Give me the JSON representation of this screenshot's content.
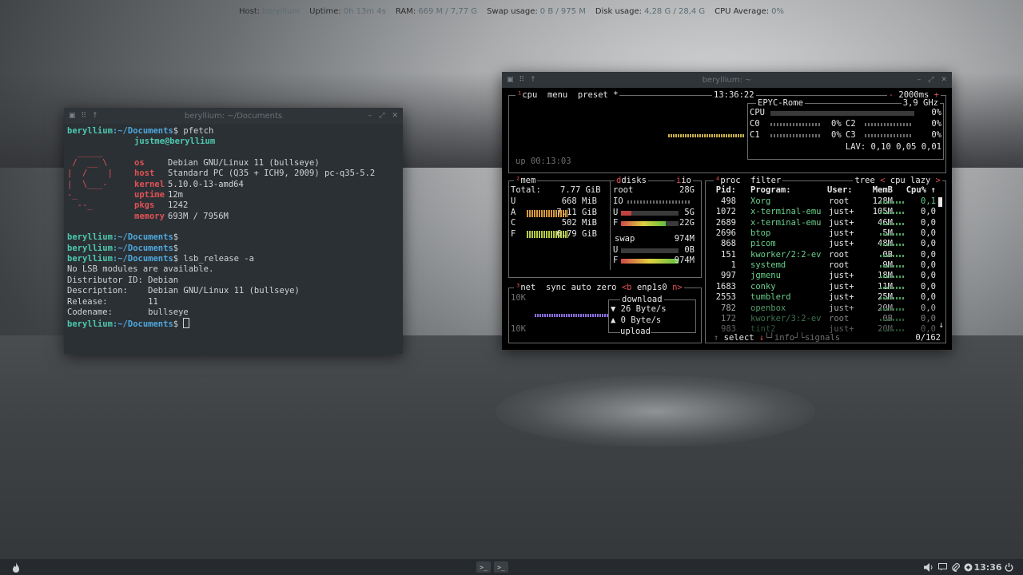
{
  "conky": [
    {
      "label": "Host:",
      "value": "beryllium"
    },
    {
      "label": "Uptime:",
      "value": "0h 13m 4s"
    },
    {
      "label": "RAM:",
      "value": "669 M / 7,77 G"
    },
    {
      "label": "Swap usage:",
      "value": "0 B / 975 M"
    },
    {
      "label": "Disk usage:",
      "value": "4,28 G / 28,4 G"
    },
    {
      "label": "CPU Average:",
      "value": "0%"
    }
  ],
  "term1": {
    "title": "beryllium: ~/Documents",
    "prompt_host": "beryllium",
    "prompt_path": ":~/Documents",
    "prompt_sign": "$",
    "cmd1": " pfetch",
    "pf_user": "justme@beryllium",
    "pf_logo": [
      "  _____",
      " /  __ \\",
      "|  /    |",
      "|  \\___-",
      "-_",
      "  --_"
    ],
    "pf_rows": [
      {
        "key": "os",
        "value": "Debian GNU/Linux 11 (bullseye)"
      },
      {
        "key": "host",
        "value": "Standard PC (Q35 + ICH9, 2009) pc-q35-5.2"
      },
      {
        "key": "kernel",
        "value": "5.10.0-13-amd64"
      },
      {
        "key": "uptime",
        "value": "12m"
      },
      {
        "key": "pkgs",
        "value": "1242"
      },
      {
        "key": "memory",
        "value": "693M / 7956M"
      }
    ],
    "cmd2": " lsb_release -a",
    "lsb": [
      "No LSB modules are available.",
      "Distributor ID: Debian",
      "Description:    Debian GNU/Linux 11 (bullseye)",
      "Release:        11",
      "Codename:       bullseye"
    ]
  },
  "btop": {
    "title": "beryllium: ~",
    "cpu_box": {
      "num": "¹",
      "tab_cpu": "cpu",
      "tab_menu": "menu",
      "tab_preset": "preset *",
      "time": "13:36:22",
      "interval": "2000ms",
      "minus": "-",
      "plus": "+",
      "uptime": "up 00:13:03"
    },
    "cpu_info": {
      "model": "EPYC-Rome",
      "freq": "3,9 GHz",
      "cpu_label": "CPU",
      "cpu_pct": "0%",
      "cores": [
        {
          "name": "C0",
          "pct": "0%"
        },
        {
          "name": "C2",
          "pct": "0%"
        },
        {
          "name": "C1",
          "pct": "0%"
        },
        {
          "name": "C3",
          "pct": "0%"
        }
      ],
      "lav": "LAV: 0,10 0,05 0,01"
    },
    "mem_box": {
      "num": "²",
      "label": "mem",
      "total_label": "Total:",
      "total": "7.77 GiB",
      "rows": [
        {
          "k": "U",
          "v": "668 MiB"
        },
        {
          "k": "A",
          "v": "7.11 GiB"
        },
        {
          "k": "C",
          "v": "502 MiB"
        },
        {
          "k": "F",
          "v": "6.79 GiB"
        }
      ]
    },
    "disks_box": {
      "label": "disks",
      "io": "io",
      "root": "root",
      "root_size": "28G",
      "io_label": "IO",
      "u_label": "U",
      "u_val": "5G",
      "f_label": "F",
      "f_val": "22G",
      "swap": "swap",
      "swap_size": "974M",
      "su_label": "U",
      "su_val": "0B",
      "sf_label": "F",
      "sf_val": "974M",
      "root_used": 0.18,
      "root_free": 0.78,
      "swap_used": 0.0,
      "swap_free": 1.0
    },
    "net_box": {
      "num": "³",
      "label": "net",
      "sync": "sync",
      "auto": "auto",
      "zero": "zero",
      "iface_prev": "<b",
      "iface": "enp1s0",
      "iface_next": "n>",
      "top_scale": "10K",
      "bot_scale": "10K",
      "download": "download",
      "down_rate": "▼ 26 Byte/s",
      "up_rate": "▲ 0 Byte/s",
      "upload": "upload"
    },
    "proc_box": {
      "num": "⁴",
      "label": "proc",
      "filter": "filter",
      "tree": "tree",
      "sort_prev": "<",
      "sort": "cpu lazy",
      "sort_next": ">",
      "h_pid": "Pid:",
      "h_prog": "Program:",
      "h_user": "User:",
      "h_mem": "MemB",
      "h_cpu": "Cpu%",
      "up_arrow": "↑",
      "down_arrow": "↓",
      "rows": [
        {
          "pid": "498",
          "prog": "Xorg",
          "user": "root",
          "mem": "128M",
          "cpu": "0,1"
        },
        {
          "pid": "1072",
          "prog": "x-terminal-emu",
          "user": "just+",
          "mem": "105M",
          "cpu": "0,0"
        },
        {
          "pid": "2689",
          "prog": "x-terminal-emu",
          "user": "just+",
          "mem": "46M",
          "cpu": "0,0"
        },
        {
          "pid": "2696",
          "prog": "btop",
          "user": "just+",
          "mem": "5M",
          "cpu": "0,0"
        },
        {
          "pid": "868",
          "prog": "picom",
          "user": "just+",
          "mem": "48M",
          "cpu": "0,0"
        },
        {
          "pid": "151",
          "prog": "kworker/2:2-ev",
          "user": "root",
          "mem": "0B",
          "cpu": "0,0"
        },
        {
          "pid": "1",
          "prog": "systemd",
          "user": "root",
          "mem": "9M",
          "cpu": "0,0"
        },
        {
          "pid": "997",
          "prog": "jgmenu",
          "user": "just+",
          "mem": "18M",
          "cpu": "0,0"
        },
        {
          "pid": "1683",
          "prog": "conky",
          "user": "just+",
          "mem": "11M",
          "cpu": "0,0"
        },
        {
          "pid": "2553",
          "prog": "tumblerd",
          "user": "just+",
          "mem": "25M",
          "cpu": "0,0"
        },
        {
          "pid": "782",
          "prog": "openbox",
          "user": "just+",
          "mem": "20M",
          "cpu": "0,0"
        },
        {
          "pid": "172",
          "prog": "kworker/3:2-ev",
          "user": "root",
          "mem": "0B",
          "cpu": "0,0"
        },
        {
          "pid": "983",
          "prog": "tint2",
          "user": "just+",
          "mem": "20M",
          "cpu": "0,0"
        }
      ],
      "select": "select",
      "info": "info",
      "signals": "signals",
      "count": "0/162"
    }
  },
  "taskbar": {
    "clock": "13:36"
  }
}
